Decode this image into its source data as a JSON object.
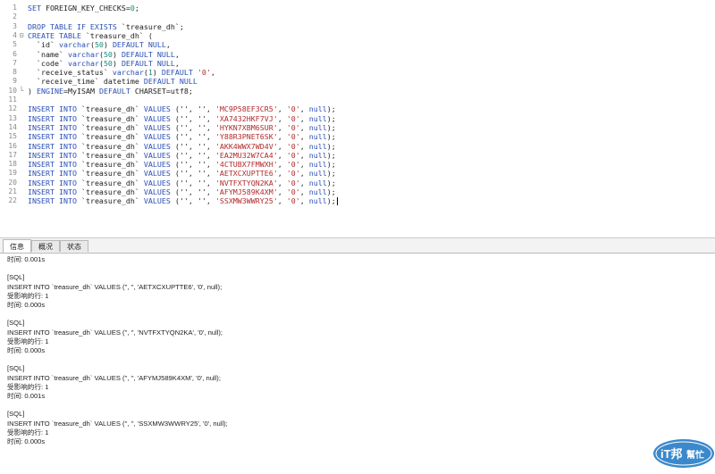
{
  "editor": {
    "lines": [
      {
        "num": "1",
        "fold": "",
        "tokens": [
          [
            "kw",
            "SET "
          ],
          [
            "plain",
            "FOREIGN_KEY_CHECKS="
          ],
          [
            "num",
            "0"
          ],
          [
            "plain",
            ";"
          ]
        ]
      },
      {
        "num": "2",
        "fold": "",
        "tokens": []
      },
      {
        "num": "3",
        "fold": "",
        "tokens": [
          [
            "kw",
            "DROP TABLE IF EXISTS "
          ],
          [
            "plain",
            "`treasure_dh`;"
          ]
        ]
      },
      {
        "num": "4",
        "fold": "⊟",
        "tokens": [
          [
            "kw",
            "CREATE TABLE "
          ],
          [
            "plain",
            "`treasure_dh` ("
          ]
        ]
      },
      {
        "num": "5",
        "fold": "",
        "tokens": [
          [
            "plain",
            "  `id` "
          ],
          [
            "kw",
            "varchar"
          ],
          [
            "plain",
            "("
          ],
          [
            "num",
            "50"
          ],
          [
            "plain",
            ") "
          ],
          [
            "kw",
            "DEFAULT NULL"
          ],
          [
            "plain",
            ","
          ]
        ]
      },
      {
        "num": "6",
        "fold": "",
        "tokens": [
          [
            "plain",
            "  `name` "
          ],
          [
            "kw",
            "varchar"
          ],
          [
            "plain",
            "("
          ],
          [
            "num",
            "50"
          ],
          [
            "plain",
            ") "
          ],
          [
            "kw",
            "DEFAULT NULL"
          ],
          [
            "plain",
            ","
          ]
        ]
      },
      {
        "num": "7",
        "fold": "",
        "tokens": [
          [
            "plain",
            "  `code` "
          ],
          [
            "kw",
            "varchar"
          ],
          [
            "plain",
            "("
          ],
          [
            "num",
            "50"
          ],
          [
            "plain",
            ") "
          ],
          [
            "kw",
            "DEFAULT NULL"
          ],
          [
            "plain",
            ","
          ]
        ]
      },
      {
        "num": "8",
        "fold": "",
        "tokens": [
          [
            "plain",
            "  `receive_status` "
          ],
          [
            "kw",
            "varchar"
          ],
          [
            "plain",
            "("
          ],
          [
            "num",
            "1"
          ],
          [
            "plain",
            ") "
          ],
          [
            "kw",
            "DEFAULT "
          ],
          [
            "str",
            "'0'"
          ],
          [
            "plain",
            ","
          ]
        ]
      },
      {
        "num": "9",
        "fold": "",
        "tokens": [
          [
            "plain",
            "  `receive_time` "
          ],
          [
            "plain",
            "datetime "
          ],
          [
            "kw",
            "DEFAULT NULL"
          ]
        ]
      },
      {
        "num": "10",
        "fold": "└",
        "tokens": [
          [
            "plain",
            ") "
          ],
          [
            "kw",
            "ENGINE"
          ],
          [
            "plain",
            "=MyISAM "
          ],
          [
            "kw",
            "DEFAULT "
          ],
          [
            "plain",
            "CHARSET=utf8;"
          ]
        ]
      },
      {
        "num": "11",
        "fold": "",
        "tokens": []
      },
      {
        "num": "12",
        "fold": "",
        "tokens": [
          [
            "kw",
            "INSERT INTO "
          ],
          [
            "plain",
            "`treasure_dh` "
          ],
          [
            "kw",
            "VALUES "
          ],
          [
            "plain",
            "('', '', "
          ],
          [
            "str",
            "'MC9P58EF3CR5'"
          ],
          [
            "plain",
            ", "
          ],
          [
            "str",
            "'0'"
          ],
          [
            "plain",
            ", "
          ],
          [
            "kw",
            "null"
          ],
          [
            "plain",
            ");"
          ]
        ]
      },
      {
        "num": "13",
        "fold": "",
        "tokens": [
          [
            "kw",
            "INSERT INTO "
          ],
          [
            "plain",
            "`treasure_dh` "
          ],
          [
            "kw",
            "VALUES "
          ],
          [
            "plain",
            "('', '', "
          ],
          [
            "str",
            "'XA7432HKF7VJ'"
          ],
          [
            "plain",
            ", "
          ],
          [
            "str",
            "'0'"
          ],
          [
            "plain",
            ", "
          ],
          [
            "kw",
            "null"
          ],
          [
            "plain",
            ");"
          ]
        ]
      },
      {
        "num": "14",
        "fold": "",
        "tokens": [
          [
            "kw",
            "INSERT INTO "
          ],
          [
            "plain",
            "`treasure_dh` "
          ],
          [
            "kw",
            "VALUES "
          ],
          [
            "plain",
            "('', '', "
          ],
          [
            "str",
            "'HYKN7XBM6SUR'"
          ],
          [
            "plain",
            ", "
          ],
          [
            "str",
            "'0'"
          ],
          [
            "plain",
            ", "
          ],
          [
            "kw",
            "null"
          ],
          [
            "plain",
            ");"
          ]
        ]
      },
      {
        "num": "15",
        "fold": "",
        "tokens": [
          [
            "kw",
            "INSERT INTO "
          ],
          [
            "plain",
            "`treasure_dh` "
          ],
          [
            "kw",
            "VALUES "
          ],
          [
            "plain",
            "('', '', "
          ],
          [
            "str",
            "'Y88R3PNET6SK'"
          ],
          [
            "plain",
            ", "
          ],
          [
            "str",
            "'0'"
          ],
          [
            "plain",
            ", "
          ],
          [
            "kw",
            "null"
          ],
          [
            "plain",
            ");"
          ]
        ]
      },
      {
        "num": "16",
        "fold": "",
        "tokens": [
          [
            "kw",
            "INSERT INTO "
          ],
          [
            "plain",
            "`treasure_dh` "
          ],
          [
            "kw",
            "VALUES "
          ],
          [
            "plain",
            "('', '', "
          ],
          [
            "str",
            "'AKK4WWX7WD4V'"
          ],
          [
            "plain",
            ", "
          ],
          [
            "str",
            "'0'"
          ],
          [
            "plain",
            ", "
          ],
          [
            "kw",
            "null"
          ],
          [
            "plain",
            ");"
          ]
        ]
      },
      {
        "num": "17",
        "fold": "",
        "tokens": [
          [
            "kw",
            "INSERT INTO "
          ],
          [
            "plain",
            "`treasure_dh` "
          ],
          [
            "kw",
            "VALUES "
          ],
          [
            "plain",
            "('', '', "
          ],
          [
            "str",
            "'EA2MU32W7CA4'"
          ],
          [
            "plain",
            ", "
          ],
          [
            "str",
            "'0'"
          ],
          [
            "plain",
            ", "
          ],
          [
            "kw",
            "null"
          ],
          [
            "plain",
            ");"
          ]
        ]
      },
      {
        "num": "18",
        "fold": "",
        "tokens": [
          [
            "kw",
            "INSERT INTO "
          ],
          [
            "plain",
            "`treasure_dh` "
          ],
          [
            "kw",
            "VALUES "
          ],
          [
            "plain",
            "('', '', "
          ],
          [
            "str",
            "'4CTUBX7FMWXH'"
          ],
          [
            "plain",
            ", "
          ],
          [
            "str",
            "'0'"
          ],
          [
            "plain",
            ", "
          ],
          [
            "kw",
            "null"
          ],
          [
            "plain",
            ");"
          ]
        ]
      },
      {
        "num": "19",
        "fold": "",
        "tokens": [
          [
            "kw",
            "INSERT INTO "
          ],
          [
            "plain",
            "`treasure_dh` "
          ],
          [
            "kw",
            "VALUES "
          ],
          [
            "plain",
            "('', '', "
          ],
          [
            "str",
            "'AETXCXUPTTE6'"
          ],
          [
            "plain",
            ", "
          ],
          [
            "str",
            "'0'"
          ],
          [
            "plain",
            ", "
          ],
          [
            "kw",
            "null"
          ],
          [
            "plain",
            ");"
          ]
        ]
      },
      {
        "num": "20",
        "fold": "",
        "tokens": [
          [
            "kw",
            "INSERT INTO "
          ],
          [
            "plain",
            "`treasure_dh` "
          ],
          [
            "kw",
            "VALUES "
          ],
          [
            "plain",
            "('', '', "
          ],
          [
            "str",
            "'NVTFXTYQN2KA'"
          ],
          [
            "plain",
            ", "
          ],
          [
            "str",
            "'0'"
          ],
          [
            "plain",
            ", "
          ],
          [
            "kw",
            "null"
          ],
          [
            "plain",
            ");"
          ]
        ]
      },
      {
        "num": "21",
        "fold": "",
        "tokens": [
          [
            "kw",
            "INSERT INTO "
          ],
          [
            "plain",
            "`treasure_dh` "
          ],
          [
            "kw",
            "VALUES "
          ],
          [
            "plain",
            "('', '', "
          ],
          [
            "str",
            "'AFYMJ589K4XM'"
          ],
          [
            "plain",
            ", "
          ],
          [
            "str",
            "'0'"
          ],
          [
            "plain",
            ", "
          ],
          [
            "kw",
            "null"
          ],
          [
            "plain",
            ");"
          ]
        ]
      },
      {
        "num": "22",
        "fold": "",
        "tokens": [
          [
            "kw",
            "INSERT INTO "
          ],
          [
            "plain",
            "`treasure_dh` "
          ],
          [
            "kw",
            "VALUES "
          ],
          [
            "plain",
            "('', '', "
          ],
          [
            "str",
            "'SSXMW3WWRY25'"
          ],
          [
            "plain",
            ", "
          ],
          [
            "str",
            "'0'"
          ],
          [
            "plain",
            ", "
          ],
          [
            "kw",
            "null"
          ],
          [
            "plain",
            ");"
          ]
        ],
        "caret": true
      }
    ]
  },
  "tabs": [
    {
      "label": "信息",
      "active": true
    },
    {
      "label": "概况",
      "active": false
    },
    {
      "label": "状态",
      "active": false
    }
  ],
  "output": {
    "lines": [
      "时间: 0.001s",
      "",
      "[SQL]",
      "INSERT INTO `treasure_dh` VALUES ('', '', 'AETXCXUPTTE6', '0', null);",
      "受影响的行: 1",
      "时间: 0.000s",
      "",
      "[SQL]",
      "INSERT INTO `treasure_dh` VALUES ('', '', 'NVTFXTYQN2KA', '0', null);",
      "受影响的行: 1",
      "时间: 0.000s",
      "",
      "[SQL]",
      "INSERT INTO `treasure_dh` VALUES ('', '', 'AFYMJ589K4XM', '0', null);",
      "受影响的行: 1",
      "时间: 0.001s",
      "",
      "[SQL]",
      "INSERT INTO `treasure_dh` VALUES ('', '', 'SSXMW3WWRY25', '0', null);",
      "受影响的行: 1",
      "时间: 0.000s"
    ]
  },
  "watermark": {
    "brand": "iT邦",
    "sub": "幫忙",
    "colors": {
      "primary": "#2a7fc8",
      "accent": "#ffffff"
    }
  },
  "colors": {
    "keyword": "#2a4fb5",
    "string": "#b12a2a",
    "number": "#18897a",
    "text": "#202020",
    "line_number": "#8a8a8a"
  }
}
